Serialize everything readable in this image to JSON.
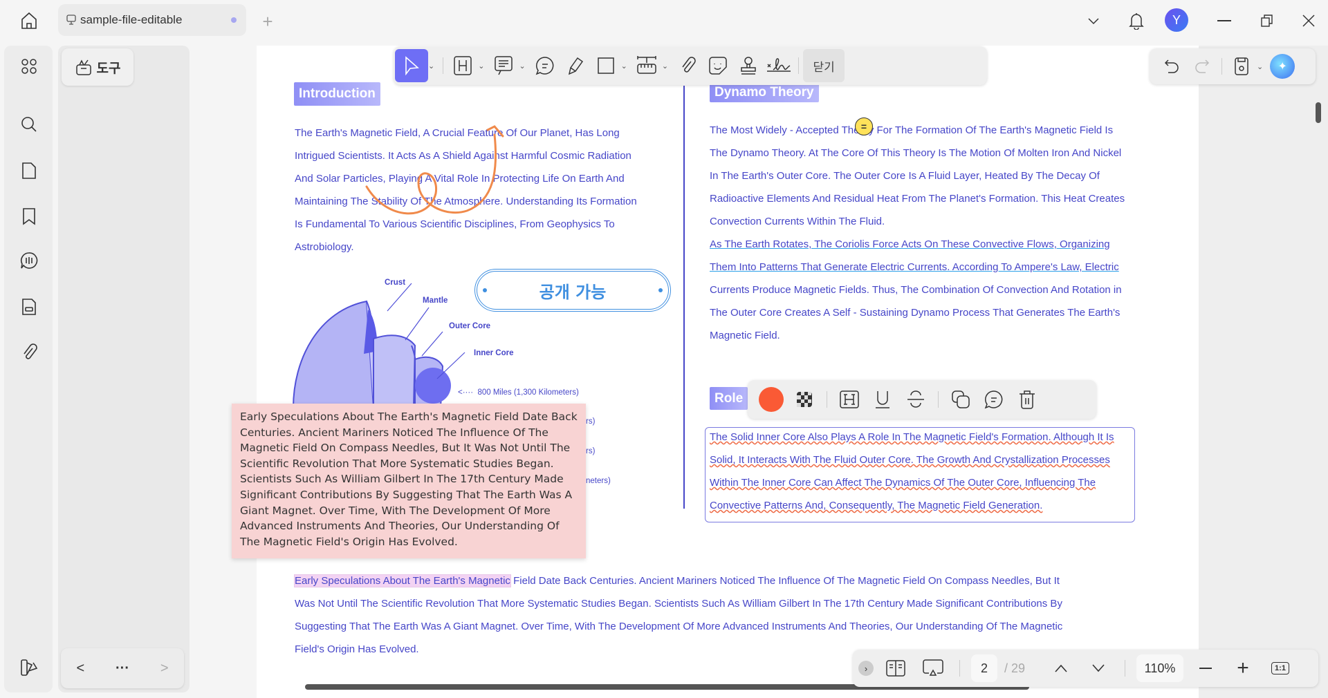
{
  "tabbar": {
    "tab_title": "sample-file-editable",
    "icons": [
      "home-icon",
      "presentation-icon",
      "new-tab-plus-icon",
      "chevron-down-icon",
      "bell-icon",
      "minimize-icon",
      "restore-icon",
      "close-icon"
    ],
    "avatar_letter": "Y"
  },
  "sidebar": {
    "icons": [
      "apps-grid-icon",
      "search-icon",
      "page-icon",
      "bookmark-icon",
      "ai-chat-icon",
      "form-icon",
      "attachment-icon",
      "theme-icon"
    ]
  },
  "tools_button": {
    "label": "도구"
  },
  "toolbar": {
    "close_label": "닫기",
    "icons": [
      "select-cursor-icon",
      "highlight-icon",
      "text-comment-icon",
      "comment-icon",
      "pencil-icon",
      "rectangle-icon",
      "measure-icon",
      "attachment-icon",
      "sticker-icon",
      "stamp-icon",
      "signature-icon"
    ]
  },
  "right_toolbar": {
    "icons": [
      "undo-icon",
      "redo-icon",
      "save-icon",
      "ai-assistant-icon"
    ]
  },
  "document": {
    "intro_heading": "Introduction",
    "intro_lines": [
      "The Earth's Magnetic Field, A Crucial Feature Of Our Planet, Has Long",
      "Intrigued Scientists. It Acts As A Shield Against Harmful Cosmic Radiation",
      "And Solar Particles, Playing A Vital Role In Protecting Life On Earth And",
      "Maintaining The Stability Of The Atmosphere. Understanding Its Formation",
      "Is Fundamental To Various Scientific Disciplines, From Geophysics To",
      "Astrobiology."
    ],
    "stamp_text": "공개 가능",
    "diagram_labels": {
      "crust": "Crust",
      "mantle": "Mantle",
      "outer_core": "Outer Core",
      "inner_core": "Inner Core",
      "inner_distance": "800 Miles (1,300 Kilometers)",
      "partial1": "rs)",
      "partial2": "rs)",
      "partial3": "neters)"
    },
    "dynamo_heading": "Dynamo Theory",
    "dynamo_lines": [
      "The Most Widely - Accepted Theory For The Formation Of The Earth's Magnetic Field Is",
      "The Dynamo Theory. At The Core Of This Theory Is The Motion Of Molten Iron And Nickel",
      "In The Earth's Outer Core. The Outer Core Is A Fluid Layer, Heated By The Decay Of",
      "Radioactive Elements And Residual Heat From The Planet's Formation. This Heat Creates",
      "Convection Currents Within The Fluid."
    ],
    "dynamo_underlined": [
      "As The Earth Rotates, The Coriolis Force Acts On These Convective Flows, Organizing",
      "Them Into Patterns That Generate Electric Currents. According To Ampere's Law, Electric"
    ],
    "dynamo_lines2": [
      "Currents Produce Magnetic Fields. Thus, The Combination Of Convection And Rotation in",
      "The Outer Core Creates A Self - Sustaining Dynamo Process That Generates The Earth's",
      "Magnetic Field."
    ],
    "role_heading": "Role",
    "role_lines": [
      "The Solid Inner Core Also Plays A Role In The Magnetic Field's Formation. Although It Is",
      "Solid, It Interacts With The Fluid Outer Core. The Growth And Crystallization Processes",
      "Within The Inner Core Can Affect The Dynamics Of The Outer Core, Influencing The",
      "Convective Patterns And, Consequently, The Magnetic Field Generation."
    ],
    "note_text": "Early Speculations About The Earth's Magnetic Field Date Back Centuries. Ancient Mariners Noticed The Influence Of The Magnetic Field On Compass Needles, But It Was Not Until The Scientific Revolution That More Systematic Studies Began. Scientists Such As William Gilbert In The 17th Century Made Significant Contributions By Suggesting That The Earth Was A Giant Magnet. Over Time, With The Development Of More Advanced Instruments And Theories, Our Understanding Of The Magnetic Field's Origin Has Evolved.",
    "bottom_highlight": "Early Speculations About The Earth's Magnetic",
    "bottom_lines": [
      " Field Date Back Centuries. Ancient Mariners Noticed The Influence Of The Magnetic Field On Compass Needles, But It",
      "Was Not Until The Scientific Revolution That More Systematic Studies Began. Scientists Such As William Gilbert In The 17th Century Made Significant Contributions By",
      "Suggesting That The Earth Was A Giant Magnet. Over Time, With The Development Of More Advanced Instruments And Theories, Our Understanding Of The Magnetic",
      "Field's Origin Has Evolved."
    ]
  },
  "markup_toolbar": {
    "color": "#fa5a35",
    "icons": [
      "color-swatch",
      "opacity-icon",
      "highlight-icon",
      "underline-icon",
      "strikethrough-icon",
      "copy-icon",
      "comment-icon",
      "delete-icon"
    ]
  },
  "page_nav": {
    "current_page": "2",
    "total": "/ 29",
    "zoom": "110%",
    "fit_label": "1:1",
    "prev": "<",
    "more": "···",
    "next": ">"
  },
  "colors": {
    "accent": "#6e6ef5",
    "text_blue": "#4646c8",
    "note_bg": "#f8d3d3",
    "scribble": "#f08a4b"
  }
}
